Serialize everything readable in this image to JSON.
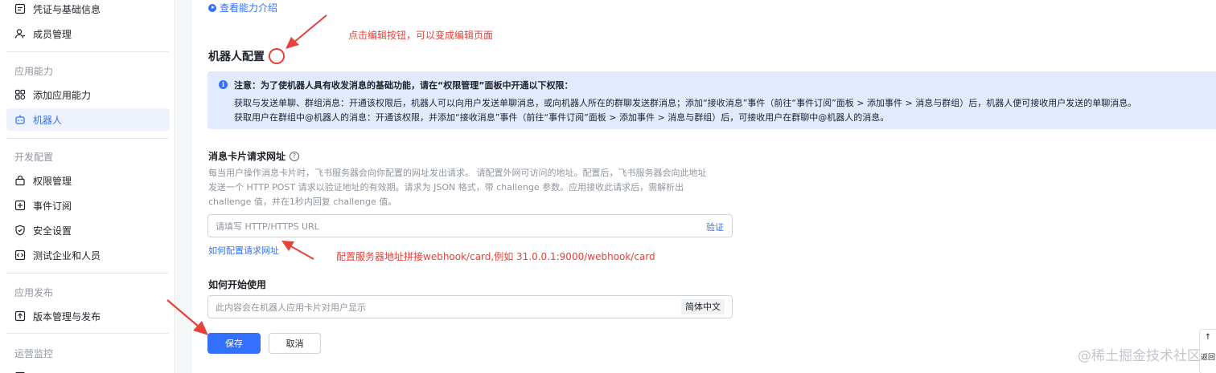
{
  "sidebar": {
    "items_top": [
      {
        "label": "凭证与基础信息",
        "icon": "credential-icon"
      },
      {
        "label": "成员管理",
        "icon": "member-icon"
      }
    ],
    "sections": [
      {
        "title": "应用能力",
        "items": [
          {
            "label": "添加应用能力",
            "icon": "app-grid-icon"
          },
          {
            "label": "机器人",
            "icon": "robot-icon",
            "active": true
          }
        ]
      },
      {
        "title": "开发配置",
        "items": [
          {
            "label": "权限管理",
            "icon": "permission-icon"
          },
          {
            "label": "事件订阅",
            "icon": "event-icon"
          },
          {
            "label": "安全设置",
            "icon": "shield-icon"
          },
          {
            "label": "测试企业和人员",
            "icon": "test-icon"
          }
        ]
      },
      {
        "title": "应用发布",
        "items": [
          {
            "label": "版本管理与发布",
            "icon": "publish-icon"
          }
        ]
      },
      {
        "title": "运营监控",
        "items": []
      }
    ]
  },
  "main": {
    "intro_link": "查看能力介绍",
    "section_title": "机器人配置",
    "notice": {
      "title": "注意：为了使机器人具有收发消息的基础功能，请在“权限管理”面板中开通以下权限：",
      "line1": "获取与发送单聊、群组消息：开通该权限后，机器人可以向用户发送单聊消息，或向机器人所在的群聊发送群消息；添加“接收消息”事件（前往“事件订阅”面板 > 添加事件 > 消息与群组）后，机器人便可接收用户发送的单聊消息。",
      "line2": "获取用户在群组中@机器人的消息：开通该权限，并添加“接收消息”事件（前往“事件订阅”面板 > 添加事件 > 消息与群组）后，可接收用户在群聊中@机器人的消息。"
    },
    "card_url": {
      "label": "消息卡片请求网址",
      "help": "?",
      "desc": [
        "每当用户操作消息卡片时，飞书服务器会向你配置的网址发出请求。 请配置外网可访问的地址。配置后，飞书服务器会向此地址",
        "发送一个 HTTP POST 请求以验证地址的有效期。请求为 JSON 格式，带 challenge 参数。应用接收此请求后，需解析出",
        "challenge 值，并在1秒内回复 challenge 值。"
      ],
      "placeholder": "请填写 HTTP/HTTPS URL",
      "verify_label": "验证",
      "howto_link": "如何配置请求网址"
    },
    "getting_started": {
      "label": "如何开始使用",
      "placeholder": "此内容会在机器人应用卡片对用户显示",
      "lang": "简体中文"
    },
    "buttons": {
      "save": "保存",
      "cancel": "取消"
    }
  },
  "annotations": {
    "edit_hint": "点击编辑按钮，可以变成编辑页面",
    "url_hint": "配置服务器地址拼接webhook/card,例如   31.0.0.1:9000/webhook/card",
    "color": "#e8413a"
  },
  "back_top": {
    "arrow": "↑",
    "label": "返回"
  },
  "watermark": "@稀土掘金技术社区",
  "colors": {
    "accent": "#3370ff",
    "notice_bg": "#e1eaff",
    "annotation": "#e8413a"
  }
}
